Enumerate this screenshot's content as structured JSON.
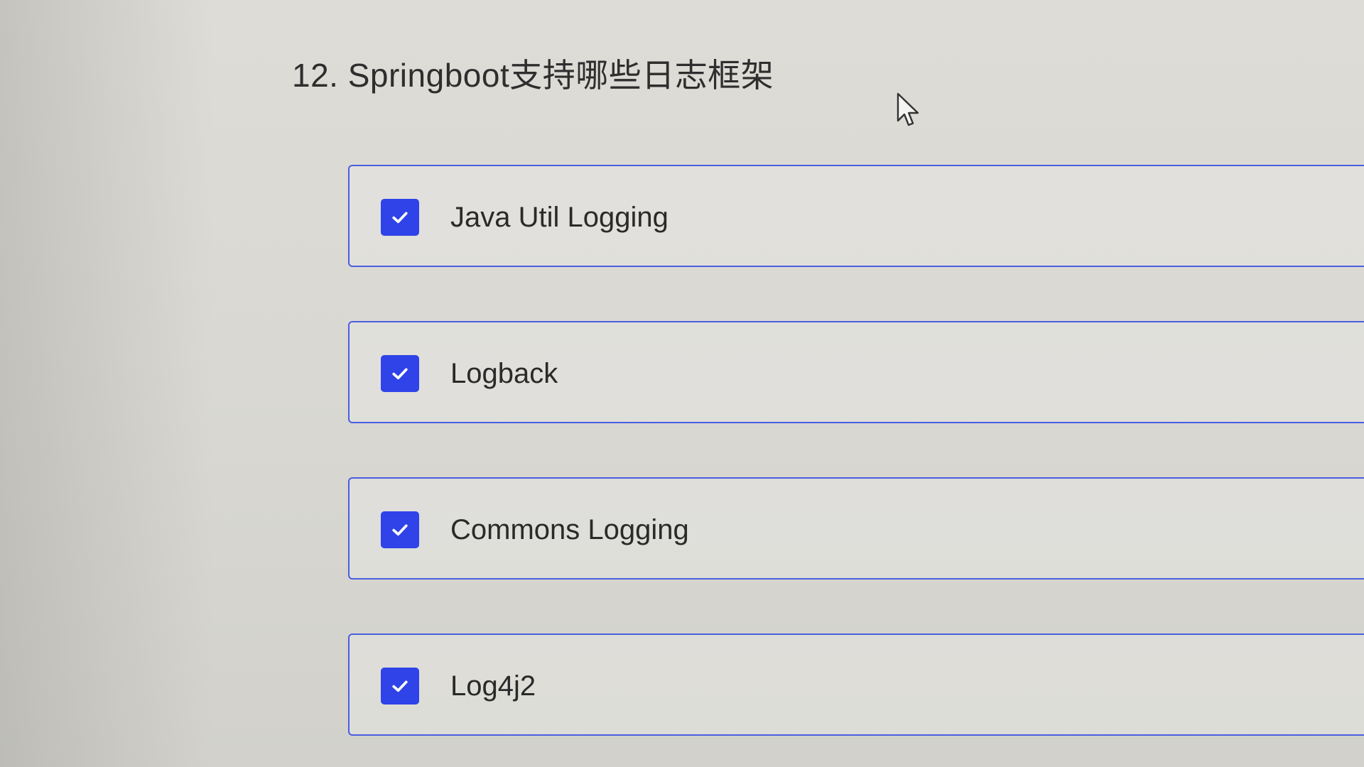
{
  "question": {
    "title": "12. Springboot支持哪些日志框架"
  },
  "options": [
    {
      "label": "Java Util Logging",
      "checked": true
    },
    {
      "label": "Logback",
      "checked": true
    },
    {
      "label": "Commons Logging",
      "checked": true
    },
    {
      "label": "Log4j2",
      "checked": true
    }
  ],
  "colors": {
    "accent": "#2f43e8",
    "border": "#4a5fe0",
    "background": "#d9d8d3"
  },
  "icons": {
    "checkbox": "check-icon",
    "cursor": "mouse-pointer-icon"
  }
}
